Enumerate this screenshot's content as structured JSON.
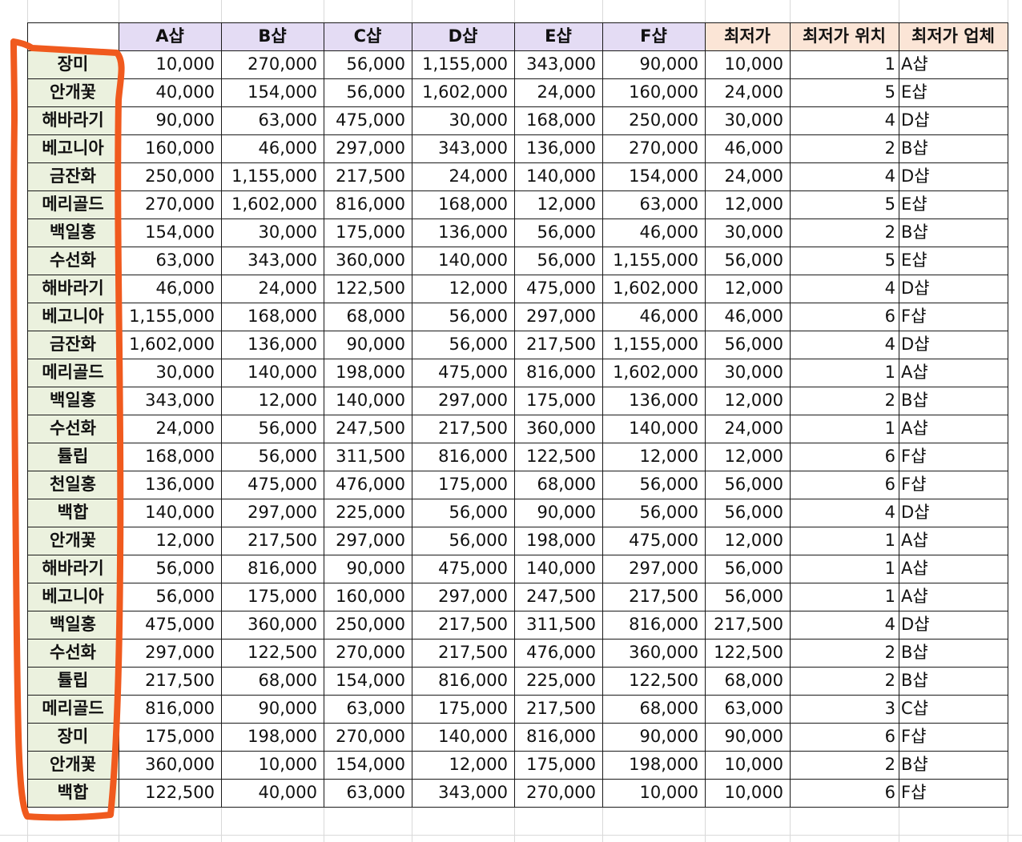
{
  "headers": {
    "shops": [
      "A샵",
      "B샵",
      "C샵",
      "D샵",
      "E샵",
      "F샵"
    ],
    "result": [
      "최저가",
      "최저가 위치",
      "최저가 업체"
    ]
  },
  "rows": [
    {
      "flower": "장미",
      "prices": [
        "10,000",
        "270,000",
        "56,000",
        "1,155,000",
        "343,000",
        "90,000"
      ],
      "min": "10,000",
      "pos": "1",
      "vendor": "A샵"
    },
    {
      "flower": "안개꽃",
      "prices": [
        "40,000",
        "154,000",
        "56,000",
        "1,602,000",
        "24,000",
        "160,000"
      ],
      "min": "24,000",
      "pos": "5",
      "vendor": "E샵"
    },
    {
      "flower": "해바라기",
      "prices": [
        "90,000",
        "63,000",
        "475,000",
        "30,000",
        "168,000",
        "250,000"
      ],
      "min": "30,000",
      "pos": "4",
      "vendor": "D샵"
    },
    {
      "flower": "베고니아",
      "prices": [
        "160,000",
        "46,000",
        "297,000",
        "343,000",
        "136,000",
        "270,000"
      ],
      "min": "46,000",
      "pos": "2",
      "vendor": "B샵"
    },
    {
      "flower": "금잔화",
      "prices": [
        "250,000",
        "1,155,000",
        "217,500",
        "24,000",
        "140,000",
        "154,000"
      ],
      "min": "24,000",
      "pos": "4",
      "vendor": "D샵"
    },
    {
      "flower": "메리골드",
      "prices": [
        "270,000",
        "1,602,000",
        "816,000",
        "168,000",
        "12,000",
        "63,000"
      ],
      "min": "12,000",
      "pos": "5",
      "vendor": "E샵"
    },
    {
      "flower": "백일홍",
      "prices": [
        "154,000",
        "30,000",
        "175,000",
        "136,000",
        "56,000",
        "46,000"
      ],
      "min": "30,000",
      "pos": "2",
      "vendor": "B샵"
    },
    {
      "flower": "수선화",
      "prices": [
        "63,000",
        "343,000",
        "360,000",
        "140,000",
        "56,000",
        "1,155,000"
      ],
      "min": "56,000",
      "pos": "5",
      "vendor": "E샵"
    },
    {
      "flower": "해바라기",
      "prices": [
        "46,000",
        "24,000",
        "122,500",
        "12,000",
        "475,000",
        "1,602,000"
      ],
      "min": "12,000",
      "pos": "4",
      "vendor": "D샵"
    },
    {
      "flower": "베고니아",
      "prices": [
        "1,155,000",
        "168,000",
        "68,000",
        "56,000",
        "297,000",
        "46,000"
      ],
      "min": "46,000",
      "pos": "6",
      "vendor": "F샵"
    },
    {
      "flower": "금잔화",
      "prices": [
        "1,602,000",
        "136,000",
        "90,000",
        "56,000",
        "217,500",
        "1,155,000"
      ],
      "min": "56,000",
      "pos": "4",
      "vendor": "D샵"
    },
    {
      "flower": "메리골드",
      "prices": [
        "30,000",
        "140,000",
        "198,000",
        "475,000",
        "816,000",
        "1,602,000"
      ],
      "min": "30,000",
      "pos": "1",
      "vendor": "A샵"
    },
    {
      "flower": "백일홍",
      "prices": [
        "343,000",
        "12,000",
        "140,000",
        "297,000",
        "175,000",
        "136,000"
      ],
      "min": "12,000",
      "pos": "2",
      "vendor": "B샵"
    },
    {
      "flower": "수선화",
      "prices": [
        "24,000",
        "56,000",
        "247,500",
        "217,500",
        "360,000",
        "140,000"
      ],
      "min": "24,000",
      "pos": "1",
      "vendor": "A샵"
    },
    {
      "flower": "튤립",
      "prices": [
        "168,000",
        "56,000",
        "311,500",
        "816,000",
        "122,500",
        "12,000"
      ],
      "min": "12,000",
      "pos": "6",
      "vendor": "F샵"
    },
    {
      "flower": "천일홍",
      "prices": [
        "136,000",
        "475,000",
        "476,000",
        "175,000",
        "68,000",
        "56,000"
      ],
      "min": "56,000",
      "pos": "6",
      "vendor": "F샵"
    },
    {
      "flower": "백합",
      "prices": [
        "140,000",
        "297,000",
        "225,000",
        "56,000",
        "90,000",
        "56,000"
      ],
      "min": "56,000",
      "pos": "4",
      "vendor": "D샵"
    },
    {
      "flower": "안개꽃",
      "prices": [
        "12,000",
        "217,500",
        "297,000",
        "56,000",
        "198,000",
        "475,000"
      ],
      "min": "12,000",
      "pos": "1",
      "vendor": "A샵"
    },
    {
      "flower": "해바라기",
      "prices": [
        "56,000",
        "816,000",
        "90,000",
        "475,000",
        "140,000",
        "297,000"
      ],
      "min": "56,000",
      "pos": "1",
      "vendor": "A샵"
    },
    {
      "flower": "베고니아",
      "prices": [
        "56,000",
        "175,000",
        "160,000",
        "297,000",
        "247,500",
        "217,500"
      ],
      "min": "56,000",
      "pos": "1",
      "vendor": "A샵"
    },
    {
      "flower": "백일홍",
      "prices": [
        "475,000",
        "360,000",
        "250,000",
        "217,500",
        "311,500",
        "816,000"
      ],
      "min": "217,500",
      "pos": "4",
      "vendor": "D샵"
    },
    {
      "flower": "수선화",
      "prices": [
        "297,000",
        "122,500",
        "270,000",
        "217,500",
        "476,000",
        "360,000"
      ],
      "min": "122,500",
      "pos": "2",
      "vendor": "B샵"
    },
    {
      "flower": "튤립",
      "prices": [
        "217,500",
        "68,000",
        "154,000",
        "816,000",
        "225,000",
        "122,500"
      ],
      "min": "68,000",
      "pos": "2",
      "vendor": "B샵"
    },
    {
      "flower": "메리골드",
      "prices": [
        "816,000",
        "90,000",
        "63,000",
        "175,000",
        "217,500",
        "68,000"
      ],
      "min": "63,000",
      "pos": "3",
      "vendor": "C샵"
    },
    {
      "flower": "장미",
      "prices": [
        "175,000",
        "198,000",
        "270,000",
        "140,000",
        "816,000",
        "90,000"
      ],
      "min": "90,000",
      "pos": "6",
      "vendor": "F샵"
    },
    {
      "flower": "안개꽃",
      "prices": [
        "360,000",
        "10,000",
        "154,000",
        "12,000",
        "175,000",
        "198,000"
      ],
      "min": "10,000",
      "pos": "2",
      "vendor": "B샵"
    },
    {
      "flower": "백합",
      "prices": [
        "122,500",
        "40,000",
        "63,000",
        "343,000",
        "270,000",
        "10,000"
      ],
      "min": "10,000",
      "pos": "6",
      "vendor": "F샵"
    }
  ],
  "annotation": {
    "shape": "freehand-highlight-outline",
    "color": "#f05a1e",
    "target": "flower-name-column"
  }
}
